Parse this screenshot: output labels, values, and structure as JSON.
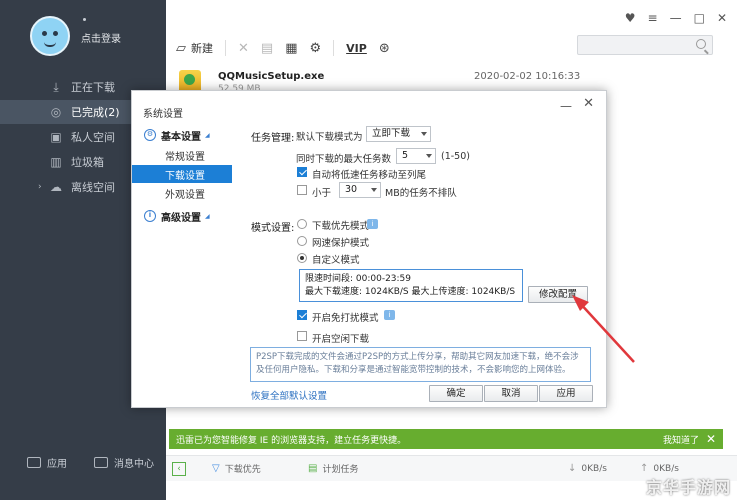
{
  "sidebar": {
    "login_text": "点击登录",
    "items": [
      {
        "label": "正在下载",
        "icon": "download-icon"
      },
      {
        "label": "已完成(2)",
        "icon": "check-circle-icon"
      },
      {
        "label": "私人空间",
        "icon": "lock-icon"
      },
      {
        "label": "垃圾箱",
        "icon": "trash-icon"
      },
      {
        "label": "离线空间",
        "icon": "cloud-icon"
      }
    ],
    "footer": {
      "apps_label": "应用",
      "msg_label": "消息中心"
    }
  },
  "toolbar": {
    "new_label": "新建",
    "vip_label": "VIP"
  },
  "task": {
    "name": "QQMusicSetup.exe",
    "size": "52.59 MB",
    "time": "2020-02-02 10:16:33"
  },
  "dialog": {
    "title": "系统设置",
    "tree": {
      "basic": "基本设置",
      "general": "常规设置",
      "download": "下载设置",
      "appearance": "外观设置",
      "advanced": "高级设置"
    },
    "task_mgmt": {
      "label": "任务管理:",
      "default_mode_label": "默认下载模式为",
      "default_mode_value": "立即下载",
      "max_tasks_label": "同时下载的最大任务数",
      "max_tasks_value": "5",
      "max_tasks_range": "(1-50)",
      "auto_move_label": "自动将低速任务移动至列尾",
      "smaller_than_label": "小于",
      "smaller_than_value": "30",
      "smaller_than_suffix": "MB的任务不排队"
    },
    "mode": {
      "label": "模式设置:",
      "download_first": "下载优先模式",
      "network_protect": "网速保护模式",
      "custom": "自定义模式",
      "limit_time": "限速时间段: 00:00-23:59",
      "limit_speed": "最大下载速度: 1024KB/S  最大上传速度: 1024KB/S",
      "modify_button": "修改配置",
      "no_disturb": "开启免打扰模式",
      "idle_download": "开启空闲下载"
    },
    "description": "P2SP下载完成的文件会通过P2SP的方式上传分享，帮助其它网友加速下载，绝不会涉及任何用户隐私。下载和分享是通过智能宽带控制的技术，不会影响您的上网体验。",
    "restore_link": "恢复全部默认设置",
    "ok_button": "确定",
    "cancel_button": "取消",
    "apply_button": "应用"
  },
  "notice": {
    "text": "迅雷已为您智能修复 IE 的浏览器支持，建立任务更快捷。",
    "ok": "我知道了"
  },
  "statusbar": {
    "download_first": "下载优先",
    "plan_task": "计划任务",
    "down_speed": "0KB/s",
    "up_speed": "0KB/s"
  },
  "watermark": "京华手游网",
  "colors": {
    "accent": "#1c7fd6",
    "notice_green": "#67ad2f",
    "sidebar_bg": "#353d48",
    "arrow_red": "#e0383c"
  }
}
